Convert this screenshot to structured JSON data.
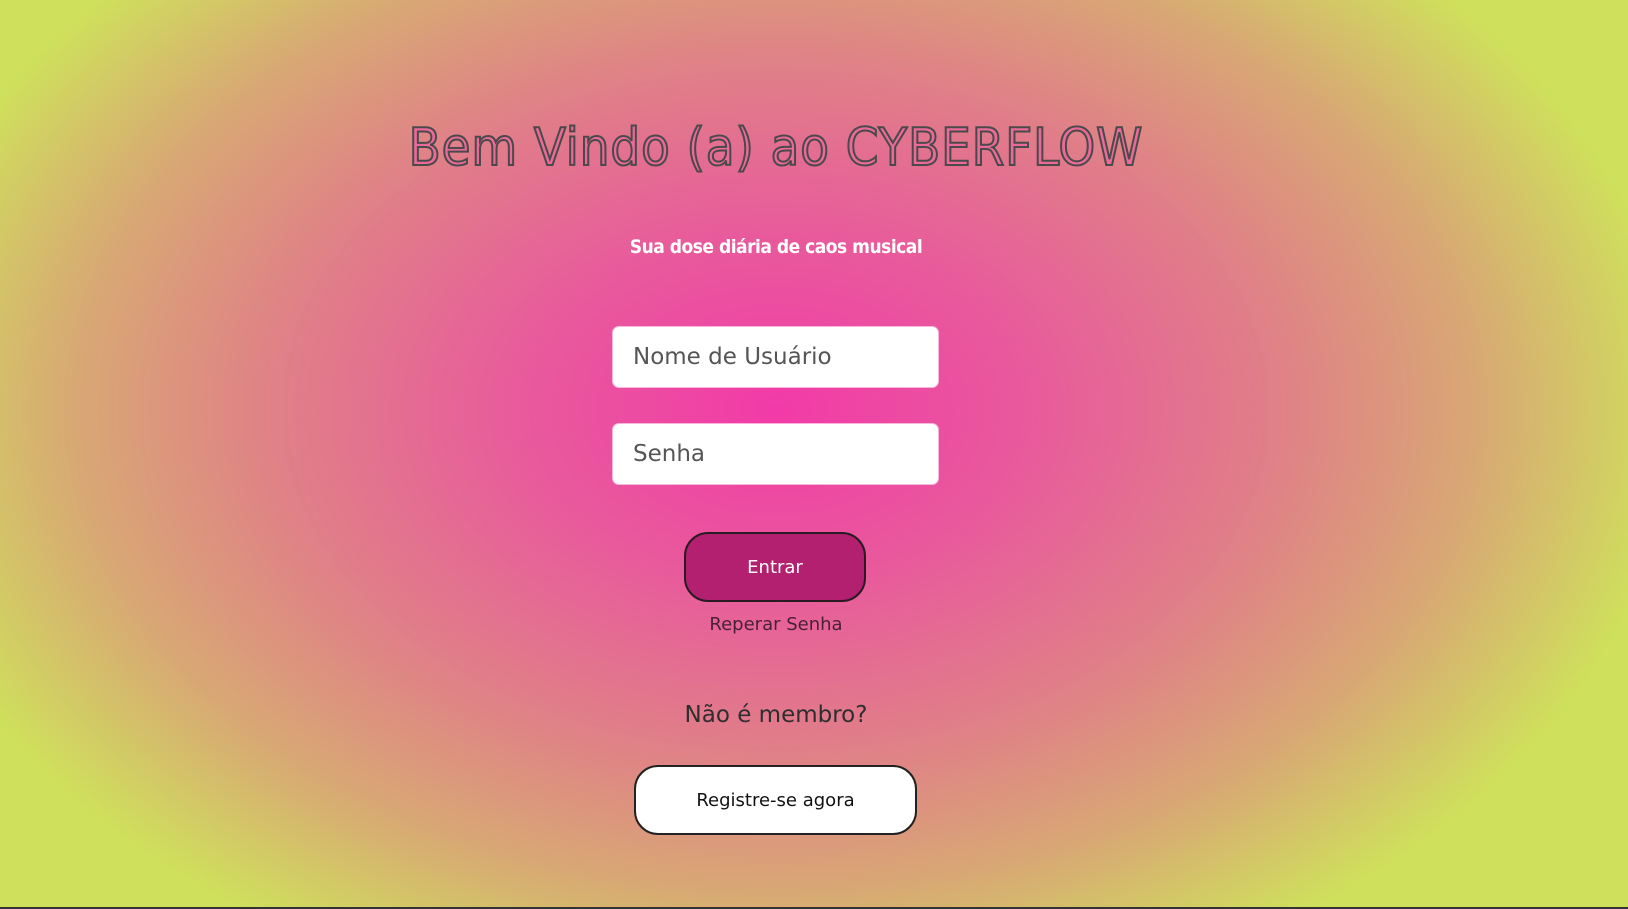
{
  "header": {
    "title": "Bem Vindo (a) ao CYBERFLOW",
    "subtitle": "Sua dose diária de caos musical"
  },
  "login_form": {
    "username_placeholder": "Nome de Usuário",
    "username_value": "",
    "password_placeholder": "Senha",
    "password_value": "",
    "submit_label": "Entrar",
    "recover_label": "Reperar Senha"
  },
  "register": {
    "prompt": "Não é membro?",
    "button_label": "Registre-se agora"
  },
  "colors": {
    "center_pink": "#f23aa8",
    "edge_green": "#cfe05c",
    "submit_button": "#b3206f",
    "register_button": "#ffffff"
  }
}
